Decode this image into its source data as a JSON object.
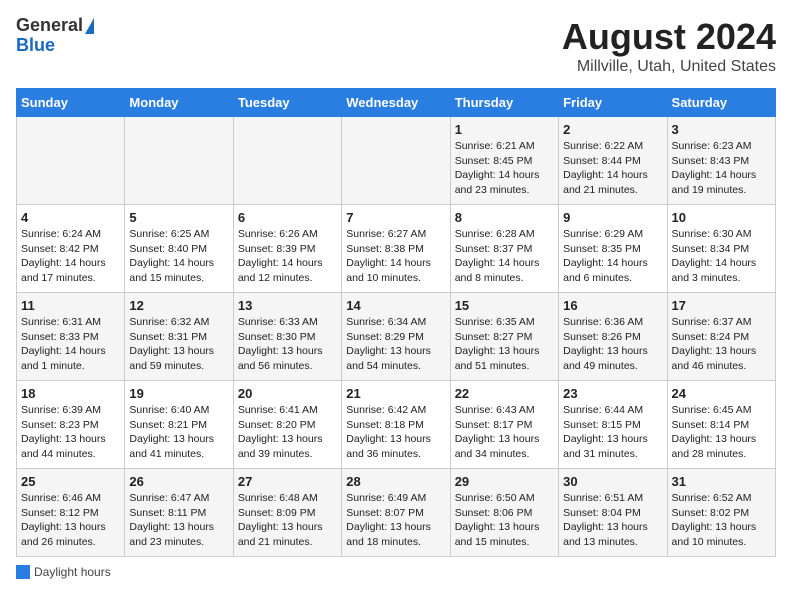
{
  "header": {
    "logo_general": "General",
    "logo_blue": "Blue",
    "main_title": "August 2024",
    "sub_title": "Millville, Utah, United States"
  },
  "days_of_week": [
    "Sunday",
    "Monday",
    "Tuesday",
    "Wednesday",
    "Thursday",
    "Friday",
    "Saturday"
  ],
  "weeks": [
    [
      {
        "day": "",
        "info": ""
      },
      {
        "day": "",
        "info": ""
      },
      {
        "day": "",
        "info": ""
      },
      {
        "day": "",
        "info": ""
      },
      {
        "day": "1",
        "info": "Sunrise: 6:21 AM\nSunset: 8:45 PM\nDaylight: 14 hours and 23 minutes."
      },
      {
        "day": "2",
        "info": "Sunrise: 6:22 AM\nSunset: 8:44 PM\nDaylight: 14 hours and 21 minutes."
      },
      {
        "day": "3",
        "info": "Sunrise: 6:23 AM\nSunset: 8:43 PM\nDaylight: 14 hours and 19 minutes."
      }
    ],
    [
      {
        "day": "4",
        "info": "Sunrise: 6:24 AM\nSunset: 8:42 PM\nDaylight: 14 hours and 17 minutes."
      },
      {
        "day": "5",
        "info": "Sunrise: 6:25 AM\nSunset: 8:40 PM\nDaylight: 14 hours and 15 minutes."
      },
      {
        "day": "6",
        "info": "Sunrise: 6:26 AM\nSunset: 8:39 PM\nDaylight: 14 hours and 12 minutes."
      },
      {
        "day": "7",
        "info": "Sunrise: 6:27 AM\nSunset: 8:38 PM\nDaylight: 14 hours and 10 minutes."
      },
      {
        "day": "8",
        "info": "Sunrise: 6:28 AM\nSunset: 8:37 PM\nDaylight: 14 hours and 8 minutes."
      },
      {
        "day": "9",
        "info": "Sunrise: 6:29 AM\nSunset: 8:35 PM\nDaylight: 14 hours and 6 minutes."
      },
      {
        "day": "10",
        "info": "Sunrise: 6:30 AM\nSunset: 8:34 PM\nDaylight: 14 hours and 3 minutes."
      }
    ],
    [
      {
        "day": "11",
        "info": "Sunrise: 6:31 AM\nSunset: 8:33 PM\nDaylight: 14 hours and 1 minute."
      },
      {
        "day": "12",
        "info": "Sunrise: 6:32 AM\nSunset: 8:31 PM\nDaylight: 13 hours and 59 minutes."
      },
      {
        "day": "13",
        "info": "Sunrise: 6:33 AM\nSunset: 8:30 PM\nDaylight: 13 hours and 56 minutes."
      },
      {
        "day": "14",
        "info": "Sunrise: 6:34 AM\nSunset: 8:29 PM\nDaylight: 13 hours and 54 minutes."
      },
      {
        "day": "15",
        "info": "Sunrise: 6:35 AM\nSunset: 8:27 PM\nDaylight: 13 hours and 51 minutes."
      },
      {
        "day": "16",
        "info": "Sunrise: 6:36 AM\nSunset: 8:26 PM\nDaylight: 13 hours and 49 minutes."
      },
      {
        "day": "17",
        "info": "Sunrise: 6:37 AM\nSunset: 8:24 PM\nDaylight: 13 hours and 46 minutes."
      }
    ],
    [
      {
        "day": "18",
        "info": "Sunrise: 6:39 AM\nSunset: 8:23 PM\nDaylight: 13 hours and 44 minutes."
      },
      {
        "day": "19",
        "info": "Sunrise: 6:40 AM\nSunset: 8:21 PM\nDaylight: 13 hours and 41 minutes."
      },
      {
        "day": "20",
        "info": "Sunrise: 6:41 AM\nSunset: 8:20 PM\nDaylight: 13 hours and 39 minutes."
      },
      {
        "day": "21",
        "info": "Sunrise: 6:42 AM\nSunset: 8:18 PM\nDaylight: 13 hours and 36 minutes."
      },
      {
        "day": "22",
        "info": "Sunrise: 6:43 AM\nSunset: 8:17 PM\nDaylight: 13 hours and 34 minutes."
      },
      {
        "day": "23",
        "info": "Sunrise: 6:44 AM\nSunset: 8:15 PM\nDaylight: 13 hours and 31 minutes."
      },
      {
        "day": "24",
        "info": "Sunrise: 6:45 AM\nSunset: 8:14 PM\nDaylight: 13 hours and 28 minutes."
      }
    ],
    [
      {
        "day": "25",
        "info": "Sunrise: 6:46 AM\nSunset: 8:12 PM\nDaylight: 13 hours and 26 minutes."
      },
      {
        "day": "26",
        "info": "Sunrise: 6:47 AM\nSunset: 8:11 PM\nDaylight: 13 hours and 23 minutes."
      },
      {
        "day": "27",
        "info": "Sunrise: 6:48 AM\nSunset: 8:09 PM\nDaylight: 13 hours and 21 minutes."
      },
      {
        "day": "28",
        "info": "Sunrise: 6:49 AM\nSunset: 8:07 PM\nDaylight: 13 hours and 18 minutes."
      },
      {
        "day": "29",
        "info": "Sunrise: 6:50 AM\nSunset: 8:06 PM\nDaylight: 13 hours and 15 minutes."
      },
      {
        "day": "30",
        "info": "Sunrise: 6:51 AM\nSunset: 8:04 PM\nDaylight: 13 hours and 13 minutes."
      },
      {
        "day": "31",
        "info": "Sunrise: 6:52 AM\nSunset: 8:02 PM\nDaylight: 13 hours and 10 minutes."
      }
    ]
  ],
  "footer": {
    "legend_label": "Daylight hours"
  }
}
